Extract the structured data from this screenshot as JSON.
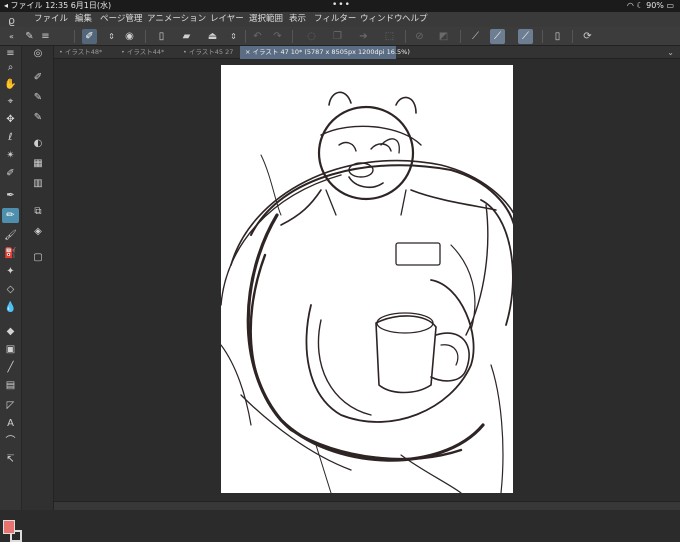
{
  "status_bar": {
    "left": "◂ ファイル  12:35  6月1日(水)",
    "center": "•••",
    "right": "90%"
  },
  "menu": {
    "items": [
      "ファイル",
      "編集",
      "ページ管理",
      "アニメーション",
      "レイヤー",
      "選択範囲",
      "表示",
      "フィルター",
      "ウィンドウ",
      "ヘルプ"
    ]
  },
  "tabs": [
    {
      "label": "• イラスト48*"
    },
    {
      "label": "• イラスト44*"
    },
    {
      "label": "• イラスト45 27"
    },
    {
      "label": "× イラスト 47 10* (5787 x 8505px 1200dpi 16.5%)"
    }
  ],
  "colors": {
    "accent": "#4f8fae",
    "tab_active": "#5b6d84",
    "main_color": "#e8726e",
    "sub_color": "#2a2a2a",
    "stroke": "#2e2424"
  },
  "icons": {
    "logo": "csp-logo-icon",
    "tab_chevron": "chevron-down-icon"
  },
  "text_tool_glyph": "A"
}
